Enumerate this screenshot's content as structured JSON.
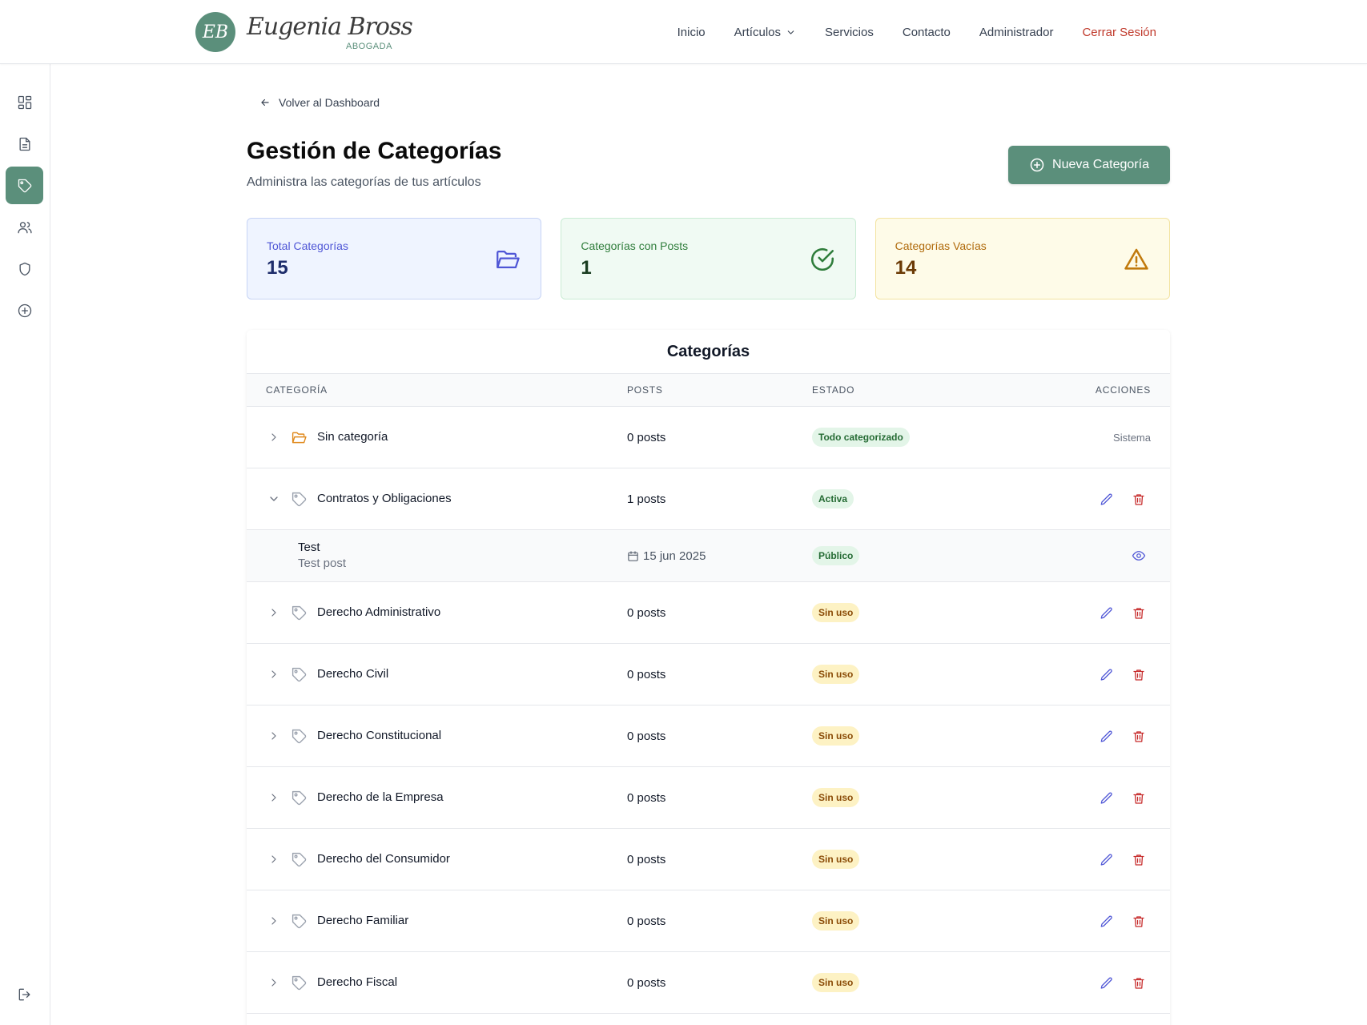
{
  "brand": {
    "initials": "EB",
    "script_name": "Eugenia Bross",
    "tagline": "ABOGADA",
    "accent_color": "#5b8f7b"
  },
  "nav": {
    "items": [
      {
        "label": "Inicio",
        "icon": null
      },
      {
        "label": "Artículos",
        "icon": "chevron-down-icon"
      },
      {
        "label": "Servicios",
        "icon": null
      },
      {
        "label": "Contacto",
        "icon": null
      },
      {
        "label": "Administrador",
        "icon": null
      },
      {
        "label": "Cerrar Sesión",
        "icon": null,
        "color": "#c0392b"
      }
    ]
  },
  "sidebar": {
    "items": [
      {
        "icon": "dashboard-grid-icon",
        "active": false
      },
      {
        "icon": "document-icon",
        "active": false
      },
      {
        "icon": "tag-icon",
        "active": true
      },
      {
        "icon": "users-icon",
        "active": false
      },
      {
        "icon": "shield-icon",
        "active": false
      },
      {
        "icon": "plus-circle-icon",
        "active": false
      }
    ],
    "bottom_icon": "logout-icon"
  },
  "page": {
    "back_label": "Volver al Dashboard",
    "title": "Gestión de Categorías",
    "subtitle": "Administra las categorías de tus artículos",
    "new_button_label": "Nueva Categoría"
  },
  "stats": [
    {
      "label": "Total Categorías",
      "value": "15",
      "icon": "folder-open-icon",
      "color": "#4f56d6"
    },
    {
      "label": "Categorías con Posts",
      "value": "1",
      "icon": "check-circle-icon",
      "color": "#2f7d3b"
    },
    {
      "label": "Categorías Vacías",
      "value": "14",
      "icon": "warning-triangle-icon",
      "color": "#c17a0d"
    }
  ],
  "table": {
    "title": "Categorías",
    "columns": [
      "CATEGORÍA",
      "POSTS",
      "ESTADO",
      "ACCIONES"
    ],
    "rows": [
      {
        "name": "Sin categoría",
        "posts": "0 posts",
        "status": "Todo categorizado",
        "status_type": "green",
        "expanded": false,
        "system": "Sistema"
      },
      {
        "name": "Contratos y Obligaciones",
        "posts": "1 posts",
        "status": "Activa",
        "status_type": "green",
        "expanded": true,
        "children": [
          {
            "title": "Test",
            "excerpt": "Test post",
            "date": "15 jun 2025",
            "status": "Público"
          }
        ]
      },
      {
        "name": "Derecho Administrativo",
        "posts": "0 posts",
        "status": "Sin uso",
        "status_type": "yellow",
        "expanded": false
      },
      {
        "name": "Derecho Civil",
        "posts": "0 posts",
        "status": "Sin uso",
        "status_type": "yellow",
        "expanded": false
      },
      {
        "name": "Derecho Constitucional",
        "posts": "0 posts",
        "status": "Sin uso",
        "status_type": "yellow",
        "expanded": false
      },
      {
        "name": "Derecho de la Empresa",
        "posts": "0 posts",
        "status": "Sin uso",
        "status_type": "yellow",
        "expanded": false
      },
      {
        "name": "Derecho del Consumidor",
        "posts": "0 posts",
        "status": "Sin uso",
        "status_type": "yellow",
        "expanded": false
      },
      {
        "name": "Derecho Familiar",
        "posts": "0 posts",
        "status": "Sin uso",
        "status_type": "yellow",
        "expanded": false
      },
      {
        "name": "Derecho Fiscal",
        "posts": "0 posts",
        "status": "Sin uso",
        "status_type": "yellow",
        "expanded": false
      }
    ]
  }
}
